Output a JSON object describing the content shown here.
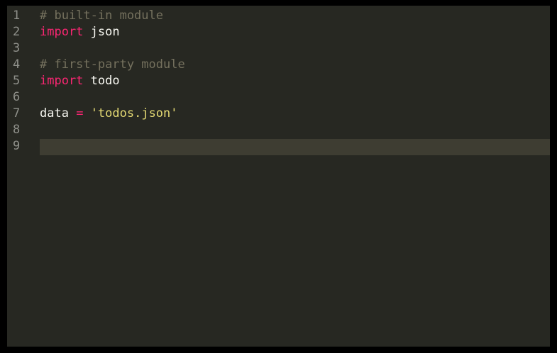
{
  "editor": {
    "theme_colors": {
      "background": "#272822",
      "current_line": "#3e3d32",
      "line_number": "#8f908a",
      "comment": "#75715e",
      "keyword": "#f92672",
      "string": "#e6db74",
      "text": "#f8f8f2"
    },
    "current_line_number": 9,
    "lines": [
      {
        "number": "1",
        "tokens": [
          {
            "type": "comment",
            "text": "# built-in module"
          }
        ]
      },
      {
        "number": "2",
        "tokens": [
          {
            "type": "keyword",
            "text": "import"
          },
          {
            "type": "plain",
            "text": " json"
          }
        ]
      },
      {
        "number": "3",
        "tokens": []
      },
      {
        "number": "4",
        "tokens": [
          {
            "type": "comment",
            "text": "# first-party module"
          }
        ]
      },
      {
        "number": "5",
        "tokens": [
          {
            "type": "keyword",
            "text": "import"
          },
          {
            "type": "plain",
            "text": " todo"
          }
        ]
      },
      {
        "number": "6",
        "tokens": []
      },
      {
        "number": "7",
        "tokens": [
          {
            "type": "plain",
            "text": "data "
          },
          {
            "type": "operator",
            "text": "="
          },
          {
            "type": "plain",
            "text": " "
          },
          {
            "type": "string",
            "text": "'todos.json'"
          }
        ]
      },
      {
        "number": "8",
        "tokens": []
      },
      {
        "number": "9",
        "tokens": []
      }
    ]
  }
}
